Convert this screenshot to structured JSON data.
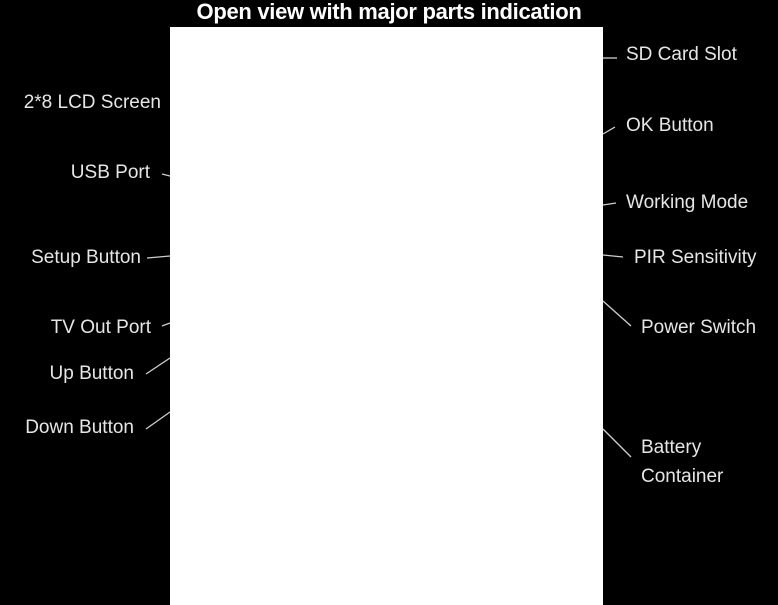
{
  "title": "Open view with major parts indication",
  "left_labels": [
    {
      "id": "lcd-screen",
      "text": "2*8 LCD Screen"
    },
    {
      "id": "usb-port",
      "text": "USB Port"
    },
    {
      "id": "setup-button",
      "text": "Setup Button"
    },
    {
      "id": "tv-out-port",
      "text": "TV Out Port"
    },
    {
      "id": "up-button",
      "text": "Up Button"
    },
    {
      "id": "down-button",
      "text": "Down Button"
    }
  ],
  "right_labels": [
    {
      "id": "sd-card-slot",
      "text": "SD Card Slot"
    },
    {
      "id": "ok-button",
      "text": "OK Button"
    },
    {
      "id": "working-mode",
      "text": "Working Mode"
    },
    {
      "id": "pir-sensitivity",
      "text": "PIR Sensitivity"
    },
    {
      "id": "power-switch",
      "text": "Power Switch"
    },
    {
      "id": "battery-container",
      "text": "Battery Container",
      "lines": [
        "Battery",
        "Container"
      ]
    }
  ]
}
